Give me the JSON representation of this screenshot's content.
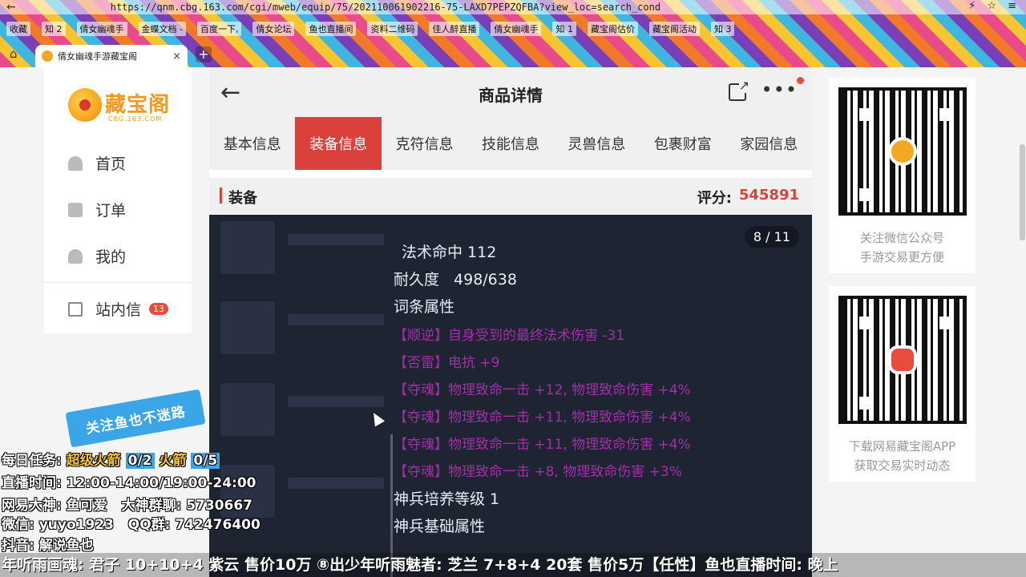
{
  "browser": {
    "url": "https://qnm.cbg.163.com/cgi/mweb/equip/75/202110061902216-75-LAXD7PEPZQFBA?view_loc=search_cond",
    "bookmarks": [
      "收藏",
      "知 2",
      "倩女幽魂手",
      "金蝶文档 -",
      "百度一下,",
      "倩女论坛",
      "鱼也直播间",
      "资料二维码",
      "佳人醉直播",
      "倩女幽魂手",
      "知 1",
      "藏宝阁估价",
      "藏宝阁活动",
      "知 3"
    ],
    "tab_title": "倩女幽魂手游藏宝阁"
  },
  "sidebar": {
    "logo_name": "藏宝阁",
    "logo_sub": "CBG.163.COM",
    "items": [
      {
        "label": "首页",
        "icon": "house-icon"
      },
      {
        "label": "订单",
        "icon": "order-icon"
      },
      {
        "label": "我的",
        "icon": "user-icon"
      },
      {
        "label": "站内信",
        "icon": "mail-icon",
        "badge": "13"
      }
    ]
  },
  "app": {
    "title": "商品详情",
    "tabs": [
      "基本信息",
      "装备信息",
      "克符信息",
      "技能信息",
      "灵兽信息",
      "包裹财富",
      "家园信息"
    ],
    "active_tab": 1,
    "section_label": "装备",
    "score_label": "评分:",
    "score_value": "545891",
    "counter": "8 / 11",
    "detail_lines": [
      {
        "text": "法术命中 112",
        "style": "normal"
      },
      {
        "label": "耐久度",
        "value": "498/638",
        "style": "kv"
      },
      {
        "text": "词条属性",
        "style": "normal"
      },
      {
        "text": "【顺逆】自身受到的最终法术伤害 -31",
        "style": "purple"
      },
      {
        "text": "【否雷】电抗 +9",
        "style": "purple"
      },
      {
        "text": "【夺魂】物理致命一击 +12, 物理致命伤害 +4%",
        "style": "purple"
      },
      {
        "text": "【夺魂】物理致命一击 +11, 物理致命伤害 +4%",
        "style": "purple"
      },
      {
        "text": "【夺魂】物理致命一击 +11, 物理致命伤害 +4%",
        "style": "purple"
      },
      {
        "text": "【夺魂】物理致命一击 +8, 物理致命伤害 +3%",
        "style": "purple"
      },
      {
        "text": "神兵培养等级 1",
        "style": "normal"
      },
      {
        "text": "神兵基础属性",
        "style": "normal"
      }
    ]
  },
  "qr_cards": [
    {
      "caption_1": "关注微信公众号",
      "caption_2": "手游交易更方便"
    },
    {
      "caption_1": "下载网易藏宝阁APP",
      "caption_2": "获取交易实时动态"
    }
  ],
  "stream": {
    "follow_banner": "关注鱼也不迷路",
    "task_label": "每日任务:",
    "task_item1": "超级火箭",
    "task_count1": "0/2",
    "task_item2": "火箭",
    "task_count2": "0/5",
    "live_time": "直播时间: 12:00-14:00/19:00-24:00",
    "wy_label": "网易大神: 鱼可爱",
    "wy_group": "大神群聊: 5730667",
    "wechat": "微信: yuyo1923",
    "qq_group": "QQ群: 742476400",
    "douyin": "抖音: 解说鱼也",
    "ticker": "年听雨画魂: 君子 10+10+4 紫云 售价10万 ⑧出少年听雨魅者: 芝兰 7+8+4 20套 售价5万【任性】鱼也直播时间: 晚上"
  }
}
